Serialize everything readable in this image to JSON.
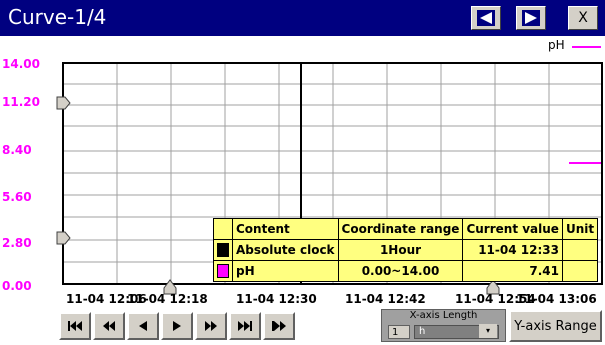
{
  "window": {
    "title": "Curve-1/4",
    "close_label": "X"
  },
  "legend": {
    "label": "pH",
    "color": "#ff00ff"
  },
  "y_axis": {
    "ticks": [
      "14.00",
      "11.20",
      "8.40",
      "5.60",
      "2.80",
      "0.00"
    ],
    "color": "#ff00ff"
  },
  "x_axis": {
    "ticks": [
      "11-04 12:06",
      "11-04 12:18",
      "11-04 12:30",
      "11-04 12:42",
      "11-04 12:54",
      "11-04 13:06"
    ]
  },
  "info_table": {
    "headers": [
      "Content",
      "Coordinate range",
      "Current value",
      "Unit"
    ],
    "rows": [
      {
        "swatch": "#000000",
        "content": "Absolute clock",
        "range": "1Hour",
        "value": "11-04 12:33",
        "unit": ""
      },
      {
        "swatch": "#ff00ff",
        "content": "pH",
        "range": "0.00~14.00",
        "value": "7.41",
        "unit": ""
      }
    ]
  },
  "nav_buttons": [
    "skip-to-start",
    "page-back",
    "step-back",
    "step-forward",
    "page-forward",
    "skip-to-end",
    "jump-to-end"
  ],
  "x_axis_length": {
    "label": "X-axis Length",
    "value": "1",
    "unit": "h"
  },
  "y_axis_range_label": "Y-axis Range",
  "colors": {
    "title_bar": "#000080",
    "table_bg": "#ffff80",
    "cursor_line": "#000000"
  },
  "chart_data": {
    "type": "line",
    "xlabel": "",
    "ylabel": "",
    "ylim": [
      0,
      14
    ],
    "x_ticks": [
      "11-04 12:06",
      "11-04 12:18",
      "11-04 12:30",
      "11-04 12:42",
      "11-04 12:54",
      "11-04 13:06"
    ],
    "series": [
      {
        "name": "pH",
        "current_value": 7.41
      }
    ],
    "cursor_time": "11-04 12:33",
    "grid": true,
    "legend_position": "top-right"
  }
}
